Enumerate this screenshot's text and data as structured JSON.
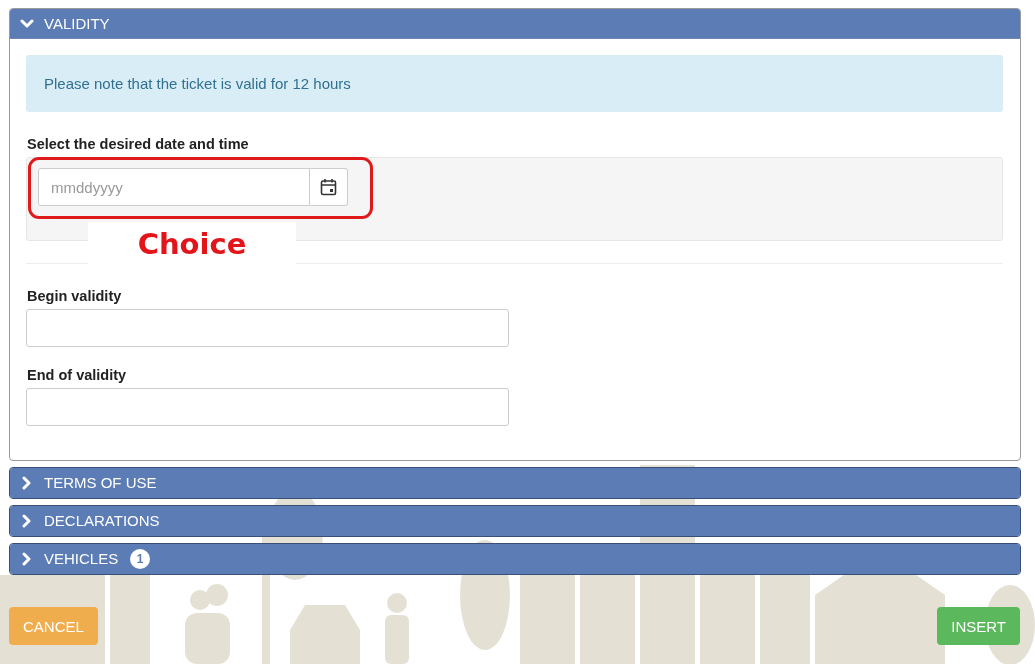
{
  "sections": [
    {
      "title": "VALIDITY",
      "expanded": true
    },
    {
      "title": "TERMS OF USE",
      "expanded": false
    },
    {
      "title": "DECLARATIONS",
      "expanded": false
    },
    {
      "title": "VEHICLES",
      "expanded": false,
      "badge": "1"
    }
  ],
  "validity": {
    "notice": "Please note that the ticket is valid for 12 hours",
    "date_label": "Select the desired date and time",
    "date_placeholder": "mmddyyyy",
    "annotation": "Choice",
    "fields": [
      {
        "label": "Begin validity"
      },
      {
        "label": "End of validity"
      }
    ]
  },
  "buttons": [
    {
      "label": "CANCEL",
      "kind": "cancel"
    },
    {
      "label": "INSERT",
      "kind": "insert"
    }
  ]
}
